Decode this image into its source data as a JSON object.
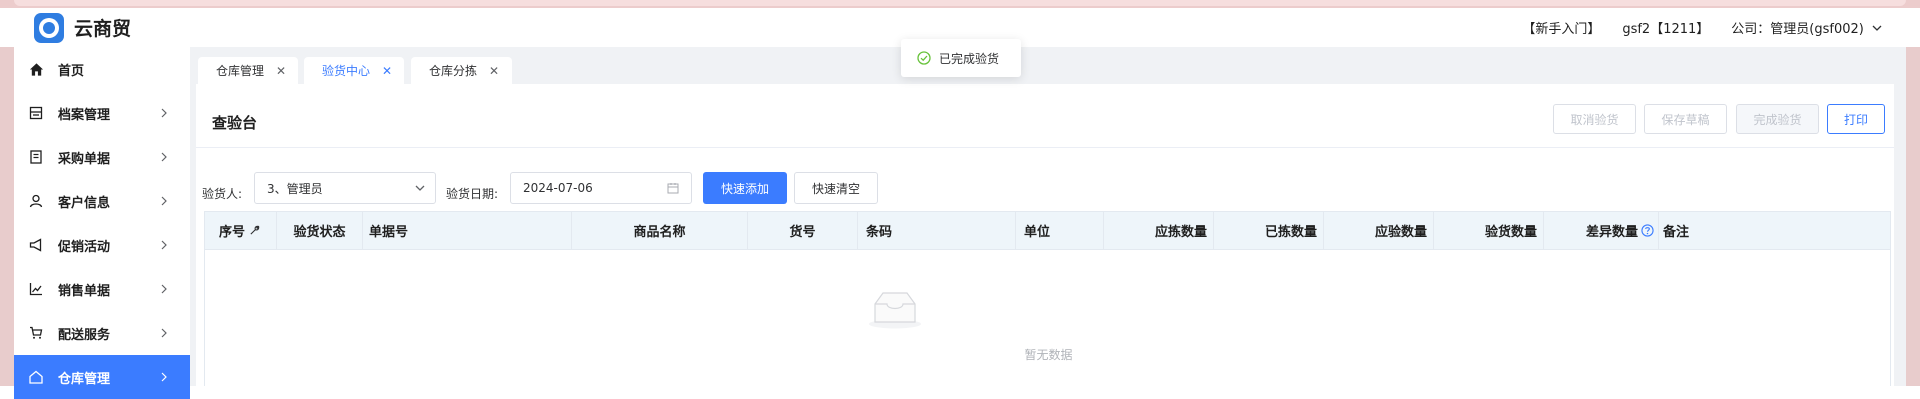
{
  "app": {
    "brand": "云商贸",
    "logo_text": ""
  },
  "header": {
    "guide": "【新手入门】",
    "user": "gsf2【1211】",
    "company": "公司：管理员(gsf002)"
  },
  "sidebar": {
    "items": [
      {
        "label": "首页",
        "icon": "home-icon",
        "has_chevron": false
      },
      {
        "label": "档案管理",
        "icon": "archive-icon",
        "has_chevron": true
      },
      {
        "label": "采购单据",
        "icon": "purchase-doc-icon",
        "has_chevron": true
      },
      {
        "label": "客户信息",
        "icon": "user-icon",
        "has_chevron": true
      },
      {
        "label": "促销活动",
        "icon": "megaphone-icon",
        "has_chevron": true
      },
      {
        "label": "销售单据",
        "icon": "chart-line-icon",
        "has_chevron": true
      },
      {
        "label": "配送服务",
        "icon": "cart-icon",
        "has_chevron": true
      },
      {
        "label": "仓库管理",
        "icon": "warehouse-icon",
        "has_chevron": true,
        "active": true
      }
    ]
  },
  "tabs": [
    {
      "label": "仓库管理",
      "close": "✕"
    },
    {
      "label": "验货中心",
      "close": "✕",
      "active": true
    },
    {
      "label": "仓库分拣",
      "close": "✕"
    }
  ],
  "toast": {
    "message": "已完成验货"
  },
  "panel": {
    "title": "查验台",
    "buttons": {
      "cancel": "取消验货",
      "save_draft": "保存草稿",
      "complete": "完成验货",
      "print": "打印"
    }
  },
  "filters": {
    "inspector_label": "验货人:",
    "inspector_value": "3、管理员",
    "date_label": "验货日期:",
    "date_value": "2024-07-06",
    "quick_add": "快速添加",
    "quick_clear": "快速清空"
  },
  "table": {
    "columns": [
      "序号",
      "验货状态",
      "单据号",
      "商品名称",
      "货号",
      "条码",
      "单位",
      "应拣数量",
      "已拣数量",
      "应验数量",
      "验货数量",
      "差异数量",
      "备注"
    ],
    "rows": [],
    "empty_text": "暂无数据"
  },
  "colors": {
    "accent": "#3b7cff",
    "success": "#67c23a",
    "frame": "#e8cccc"
  }
}
